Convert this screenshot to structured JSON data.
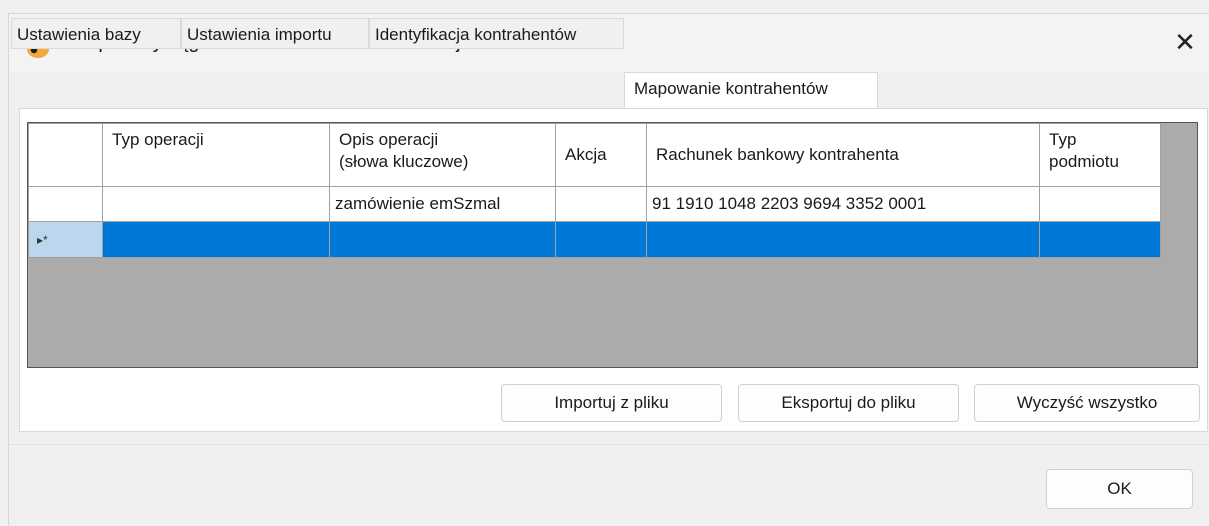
{
  "window": {
    "title": "Eksport wyciągów do Finka FK \\ KPR - wersja 1.0",
    "close_glyph": "✕"
  },
  "tabs": [
    {
      "label": "Ustawienia bazy"
    },
    {
      "label": "Ustawienia importu"
    },
    {
      "label": "Identyfikacja kontrahentów"
    },
    {
      "label": "Mapowanie kontrahentów",
      "active": true
    }
  ],
  "grid": {
    "columns": [
      "Typ operacji",
      "Opis operacji (słowa kluczowe)",
      "Akcja",
      "Rachunek bankowy kontrahenta",
      "Typ podmiotu"
    ],
    "column_lines": {
      "opis_1": "Opis operacji",
      "opis_2": "(słowa kluczowe)",
      "typ_1": "Typ",
      "typ_2": "podmiotu"
    },
    "rows": [
      {
        "typ_operacji": "",
        "opis": "zamówienie emSzmal",
        "akcja": "",
        "rachunek": "91 1910 1048 2203 9694 3352 0001",
        "typ_podmiotu": ""
      }
    ],
    "new_row_marker": "▸*"
  },
  "buttons": {
    "import": "Importuj z pliku",
    "export": "Eksportuj do pliku",
    "clear": "Wyczyść wszystko",
    "ok": "OK"
  },
  "icons": {
    "app": "money-bag-icon",
    "close": "close-icon"
  },
  "colors": {
    "selection": "#0078d7",
    "row_header_selected": "#bcd6ee",
    "grid_background": "#ababab"
  }
}
